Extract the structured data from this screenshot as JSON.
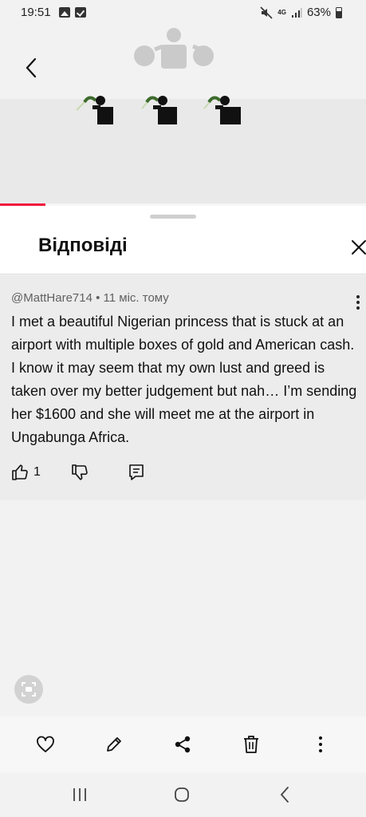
{
  "status_bar": {
    "time": "19:51",
    "network_label": "4G",
    "battery_percent": "63%",
    "battery_level": 0.63,
    "icons": [
      "gallery-icon",
      "check-icon",
      "mute-icon",
      "network-4g-icon",
      "signal-icon",
      "battery-icon"
    ]
  },
  "video": {
    "progress_fraction": 0.125,
    "accent_color": "#f2143c",
    "icons": [
      "back-arrow-icon",
      "money-bag-person-icon",
      "dancing-figure-emoji"
    ]
  },
  "sheet": {
    "title": "Відповіді",
    "close_icon": "close-x-icon"
  },
  "comment": {
    "meta": "@MattHare714 • 11 міс. тому",
    "text": "I met a beautiful Nigerian princess that is stuck at an airport with multiple boxes of gold and American cash.  I know it may seem that my own lust and greed is taken over my better judgement but nah… I’m sending her $1600 and she will meet me at the airport in Ungabunga Africa.",
    "like_count": "1",
    "icons": [
      "thumbs-up-icon",
      "thumbs-down-icon",
      "reply-icon",
      "more-vertical-icon"
    ]
  },
  "screenshot_toolbar": {
    "icons": [
      "screenshot-capture-icon",
      "heart-icon",
      "edit-pencil-icon",
      "share-icon",
      "trash-icon",
      "more-vertical-icon"
    ]
  },
  "nav_bar": {
    "icons": [
      "recents-icon",
      "home-icon",
      "back-icon"
    ]
  }
}
